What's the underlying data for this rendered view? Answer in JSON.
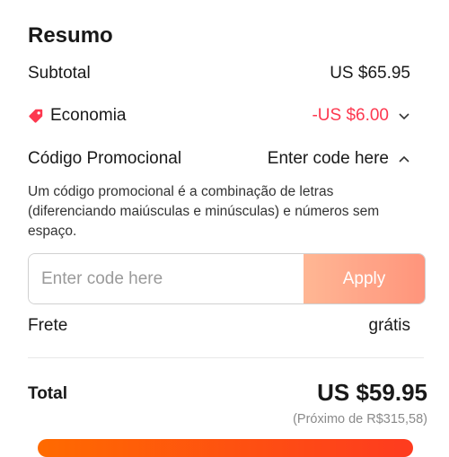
{
  "summary": {
    "title": "Resumo",
    "subtotal_label": "Subtotal",
    "subtotal_value": "US $65.95",
    "savings_label": "Economia",
    "savings_value": "-US $6.00",
    "promo_label": "Código Promocional",
    "promo_toggle": "Enter code here",
    "promo_description": "Um código promocional é a combinação de letras (diferenciando maiúsculas e minúsculas) e números sem espaço.",
    "promo_placeholder": "Enter code here",
    "apply_label": "Apply",
    "shipping_label": "Frete",
    "shipping_value": "grátis",
    "total_label": "Total",
    "total_value": "US $59.95",
    "total_local": "(Próximo de R$315,58)"
  },
  "colors": {
    "discount_red": "#fd384f",
    "apply_gradient_start": "#ffb38f",
    "apply_gradient_end": "#ff8f75",
    "checkout_orange": "#ff6a00"
  },
  "icons": {
    "savings": "price-tag-icon",
    "savings_toggle": "chevron-down-icon",
    "promo_toggle": "chevron-up-icon"
  }
}
